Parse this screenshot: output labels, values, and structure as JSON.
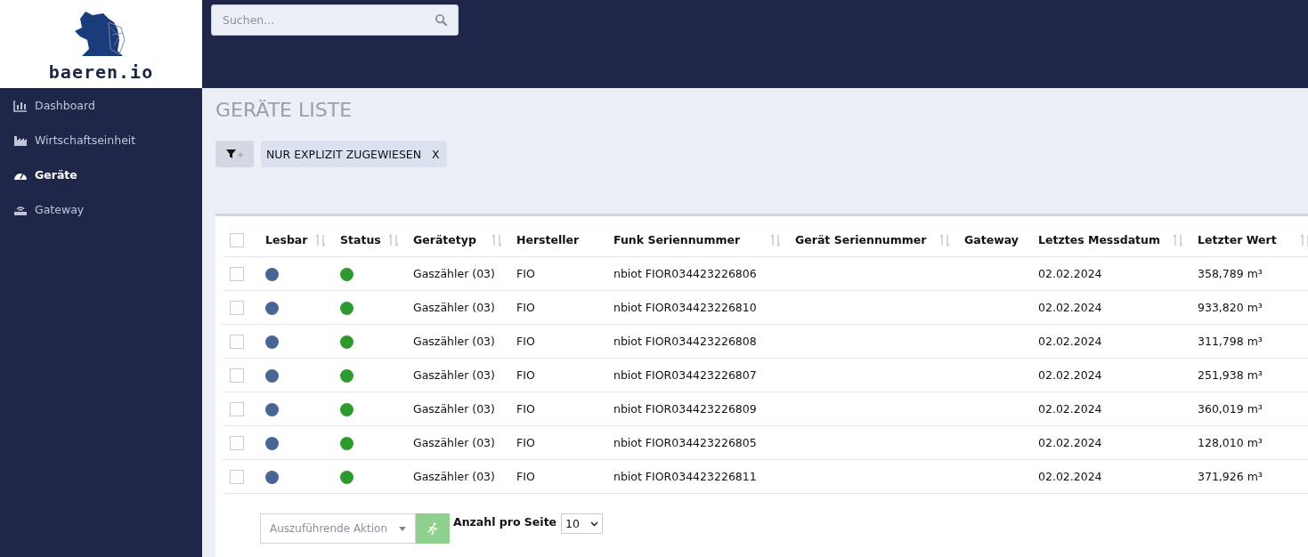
{
  "logo": {
    "text": "baeren.io"
  },
  "search": {
    "placeholder": "Suchen..."
  },
  "sidebar": {
    "items": [
      {
        "label": "Dashboard",
        "selected": false
      },
      {
        "label": "Wirtschaftseinheit",
        "selected": false
      },
      {
        "label": "Geräte",
        "selected": true
      },
      {
        "label": "Gateway",
        "selected": false
      }
    ]
  },
  "page_title": "GERÄTE LISTE",
  "filter": {
    "chip": "NUR EXPLIZIT ZUGEWIESEN",
    "chip_close": "X"
  },
  "table": {
    "all_checked": false,
    "columns": [
      {
        "label": "Lesbar",
        "sortable": true
      },
      {
        "label": "Status",
        "sortable": true
      },
      {
        "label": "Gerätetyp",
        "sortable": true
      },
      {
        "label": "Hersteller",
        "sortable": false
      },
      {
        "label": "Funk Seriennummer",
        "sortable": true
      },
      {
        "label": "Gerät Seriennummer",
        "sortable": true
      },
      {
        "label": "Gateway",
        "sortable": false
      },
      {
        "label": "Letztes Messdatum",
        "sortable": true
      },
      {
        "label": "Letzter Wert",
        "sortable": true
      }
    ],
    "rows": [
      {
        "checked": false,
        "readable": true,
        "status_ok": true,
        "cells": [
          "",
          "",
          "Gaszähler (03)",
          "FIO",
          "nbiot FIOR034423226806",
          "",
          "",
          "02.02.2024",
          "358,789 m³"
        ]
      },
      {
        "checked": false,
        "readable": true,
        "status_ok": true,
        "cells": [
          "",
          "",
          "Gaszähler (03)",
          "FIO",
          "nbiot FIOR034423226810",
          "",
          "",
          "02.02.2024",
          "933,820 m³"
        ]
      },
      {
        "checked": false,
        "readable": true,
        "status_ok": true,
        "cells": [
          "",
          "",
          "Gaszähler (03)",
          "FIO",
          "nbiot FIOR034423226808",
          "",
          "",
          "02.02.2024",
          "311,798 m³"
        ]
      },
      {
        "checked": false,
        "readable": true,
        "status_ok": true,
        "cells": [
          "",
          "",
          "Gaszähler (03)",
          "FIO",
          "nbiot FIOR034423226807",
          "",
          "",
          "02.02.2024",
          "251,938 m³"
        ]
      },
      {
        "checked": false,
        "readable": true,
        "status_ok": true,
        "cells": [
          "",
          "",
          "Gaszähler (03)",
          "FIO",
          "nbiot FIOR034423226809",
          "",
          "",
          "02.02.2024",
          "360,019 m³"
        ]
      },
      {
        "checked": false,
        "readable": true,
        "status_ok": true,
        "cells": [
          "",
          "",
          "Gaszähler (03)",
          "FIO",
          "nbiot FIOR034423226805",
          "",
          "",
          "02.02.2024",
          "128,010 m³"
        ]
      },
      {
        "checked": false,
        "readable": true,
        "status_ok": true,
        "cells": [
          "",
          "",
          "Gaszähler (03)",
          "FIO",
          "nbiot FIOR034423226811",
          "",
          "",
          "02.02.2024",
          "371,926 m³"
        ]
      }
    ]
  },
  "footer": {
    "action_placeholder": "Auszuführende Aktion",
    "per_page_label": "Anzahl pro Seite",
    "per_page_value": "10"
  }
}
